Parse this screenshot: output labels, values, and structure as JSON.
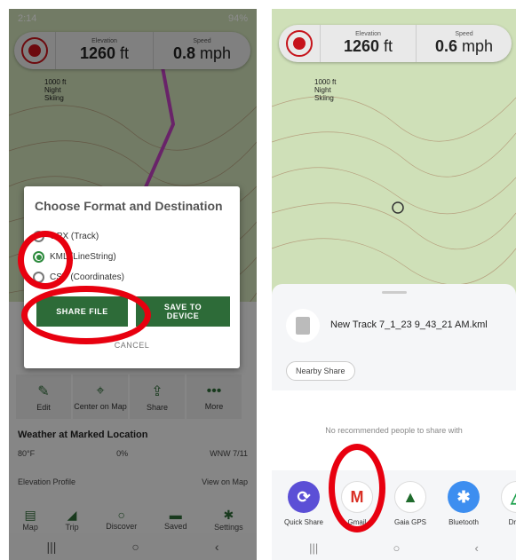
{
  "left": {
    "status": {
      "time": "2:14",
      "battery": "94%"
    },
    "recbar": {
      "elev_label": "Elevation",
      "elev_value": "1260",
      "elev_unit": "ft",
      "speed_label": "Speed",
      "speed_value": "0.8",
      "speed_unit": "mph"
    },
    "map_label": "1000 ft\nNight\nSkiing",
    "dialog": {
      "title": "Choose Format and Destination",
      "options": [
        "GPX (Track)",
        "KML (LineString)",
        "CSV (Coordinates)"
      ],
      "share": "SHARE FILE",
      "save": "SAVE TO DEVICE",
      "cancel": "CANCEL"
    },
    "actions": [
      {
        "label": "Edit",
        "icon": "pencil-icon"
      },
      {
        "label": "Center on Map",
        "icon": "center-icon"
      },
      {
        "label": "Share",
        "icon": "share-icon"
      },
      {
        "label": "More",
        "icon": "more-icon"
      }
    ],
    "weather": {
      "title": "Weather at Marked Location",
      "temp": "80°F",
      "precip": "0%",
      "wind": "WNW 7/11"
    },
    "elevation": {
      "label": "Elevation Profile",
      "link": "View on Map"
    },
    "tabs": [
      {
        "label": "Map",
        "icon": "map-icon"
      },
      {
        "label": "Trip",
        "icon": "chart-icon"
      },
      {
        "label": "Discover",
        "icon": "search-icon"
      },
      {
        "label": "Saved",
        "icon": "folder-icon"
      },
      {
        "label": "Settings",
        "icon": "gear-icon"
      }
    ]
  },
  "right": {
    "recbar": {
      "elev_label": "Elevation",
      "elev_value": "1260",
      "elev_unit": "ft",
      "speed_label": "Speed",
      "speed_value": "0.6",
      "speed_unit": "mph"
    },
    "map_label": "1000 ft\nNight\nSkiing",
    "file_name": "New Track 7_1_23 9_43_21 AM.kml",
    "nearby": "Nearby Share",
    "no_rec": "No recommended people to share with",
    "apps": [
      {
        "label": "Quick Share",
        "color": "#5b4fd6",
        "glyph": "⟳"
      },
      {
        "label": "Gmail",
        "color": "#ffffff",
        "glyph": "M"
      },
      {
        "label": "Gaia GPS",
        "color": "#ffffff",
        "glyph": "▲"
      },
      {
        "label": "Bluetooth",
        "color": "#3d8ef0",
        "glyph": "✱"
      },
      {
        "label": "Drive",
        "color": "#ffffff",
        "glyph": "△"
      }
    ]
  }
}
